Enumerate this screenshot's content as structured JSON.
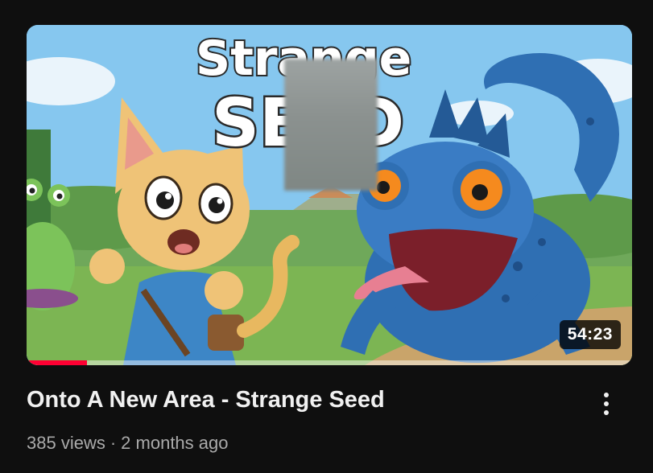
{
  "video": {
    "title": "Onto A New Area - Strange Seed",
    "views": "385 views",
    "separator": "·",
    "age": "2 months ago",
    "duration": "54:23",
    "watch_progress": 0.1,
    "thumbnail_text": {
      "line1": "Strange",
      "line2": "SEED"
    }
  },
  "icons": {
    "menu": "more-vert-icon"
  },
  "colors": {
    "background": "#0f0f0f",
    "progress": "#ff0033",
    "meta_text": "#aaaaaa"
  }
}
